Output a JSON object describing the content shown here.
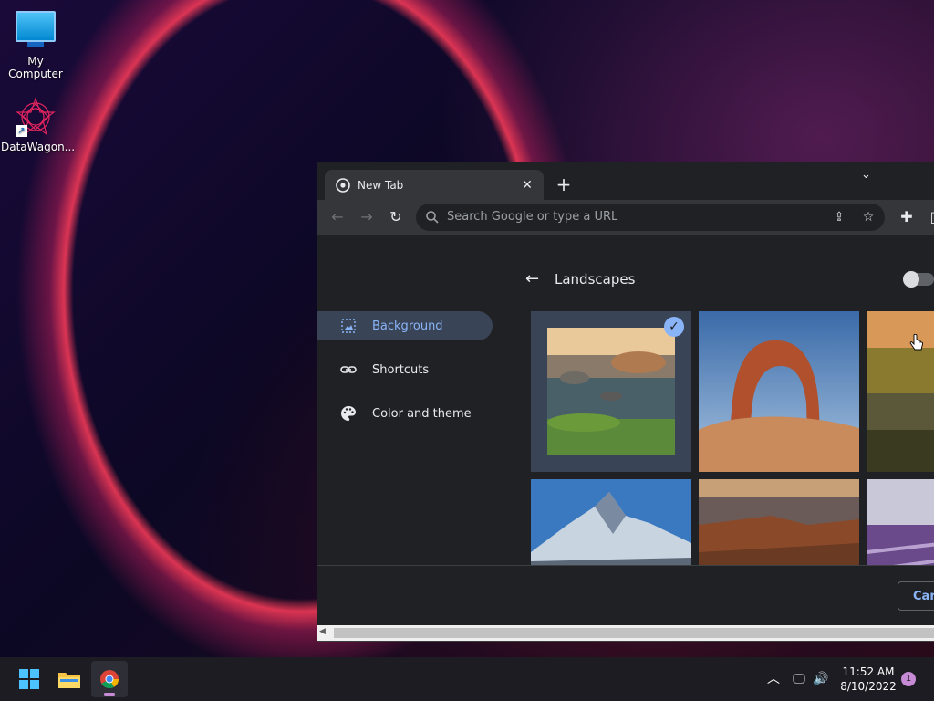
{
  "desktop": {
    "icons": [
      {
        "label": "My Computer"
      },
      {
        "label": "DataWagon..."
      }
    ]
  },
  "browser": {
    "tab": {
      "title": "New Tab"
    },
    "omnibox": {
      "placeholder": "Search Google or type a URL"
    },
    "customize": {
      "panel_title": "Landscapes",
      "sidebar": [
        {
          "label": "Background",
          "icon": "image-icon",
          "active": true
        },
        {
          "label": "Shortcuts",
          "icon": "link-icon",
          "active": false
        },
        {
          "label": "Color and theme",
          "icon": "palette-icon",
          "active": false
        }
      ],
      "cancel_label": "Canc"
    }
  },
  "taskbar": {
    "time": "11:52 AM",
    "date": "8/10/2022",
    "notifications": "1"
  },
  "colors": {
    "accent": "#8ab4f8",
    "selected_bg": "#394457",
    "chrome_dark": "#202124",
    "toolbar": "#35363a"
  }
}
